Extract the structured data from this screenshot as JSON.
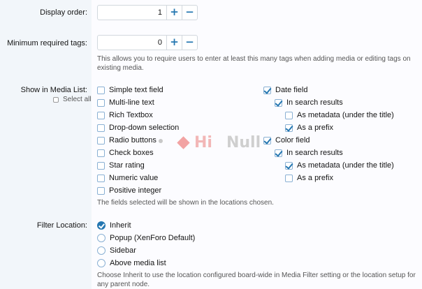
{
  "display_order": {
    "label": "Display order:",
    "value": "1",
    "plus": "+",
    "minus": "−"
  },
  "min_tags": {
    "label": "Minimum required tags:",
    "value": "0",
    "plus": "+",
    "minus": "−",
    "hint": "This allows you to require users to enter at least this many tags when adding media or editing tags on existing media."
  },
  "media_list": {
    "label": "Show in Media List:",
    "select_all": "Select all",
    "left_options": [
      "Simple text field",
      "Multi-line text",
      "Rich Textbox",
      "Drop-down selection",
      "Radio buttons",
      "Check boxes",
      "Star rating",
      "Numeric value",
      "Positive integer"
    ],
    "right_options": {
      "date_field": "Date field",
      "date_in_search": "In search results",
      "date_as_metadata": "As metadata (under the title)",
      "date_as_prefix": "As a prefix",
      "color_field": "Color field",
      "color_in_search": "In search results",
      "color_as_metadata": "As metadata (under the title)",
      "color_as_prefix": "As a prefix"
    },
    "hint": "The fields selected will be shown in the locations chosen."
  },
  "filter_location": {
    "label": "Filter Location:",
    "options": [
      "Inherit",
      "Popup (XenForo Default)",
      "Sidebar",
      "Above media list"
    ],
    "selected": "Inherit",
    "hint": "Choose Inherit to use the location configured board-wide in Media Filter setting or the location setup for any parent node."
  },
  "watermark": {
    "text_a": "Hi",
    "text_b": "Null"
  },
  "colors": {
    "accent": "#2577b1",
    "label_bg": "#f2f6fa",
    "panel_bg": "#fcfcff"
  }
}
